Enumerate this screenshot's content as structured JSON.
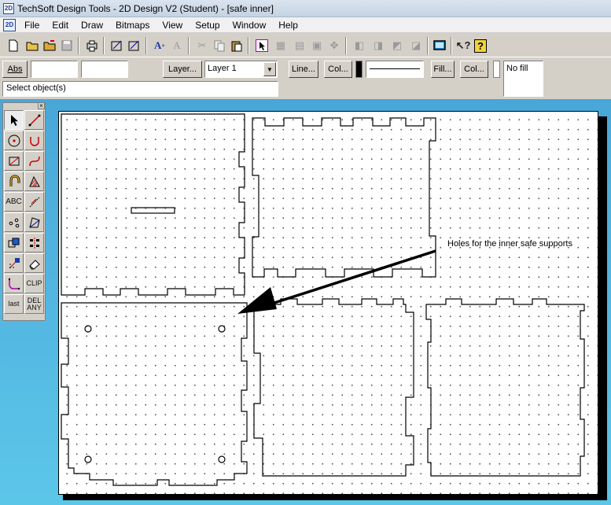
{
  "window": {
    "title": "TechSoft Design Tools - 2D Design V2 (Student) - [safe inner]",
    "app_icon": "2D"
  },
  "menu": {
    "items": [
      "File",
      "Edit",
      "Draw",
      "Bitmaps",
      "View",
      "Setup",
      "Window",
      "Help"
    ]
  },
  "propbar": {
    "abs_label": "Abs",
    "coord_x": "",
    "coord_y": "",
    "layer_button": "Layer...",
    "layer_value": "Layer 1",
    "line_button": "Line...",
    "col_button_1": "Col...",
    "fill_button": "Fill...",
    "col_button_2": "Col...",
    "fill_value": "No fill",
    "status": "Select object(s)"
  },
  "palette": {
    "text_tool": "ABC",
    "clip_tool": "CLIP",
    "last_tool": "last",
    "del_any_tool_1": "DEL",
    "del_any_tool_2": "ANY"
  },
  "canvas": {
    "annotation": "Holes for the inner safe supports"
  },
  "colors": {
    "workspace": "#4fb3df",
    "sheet": "#ffffff",
    "line_color": "#000000"
  }
}
